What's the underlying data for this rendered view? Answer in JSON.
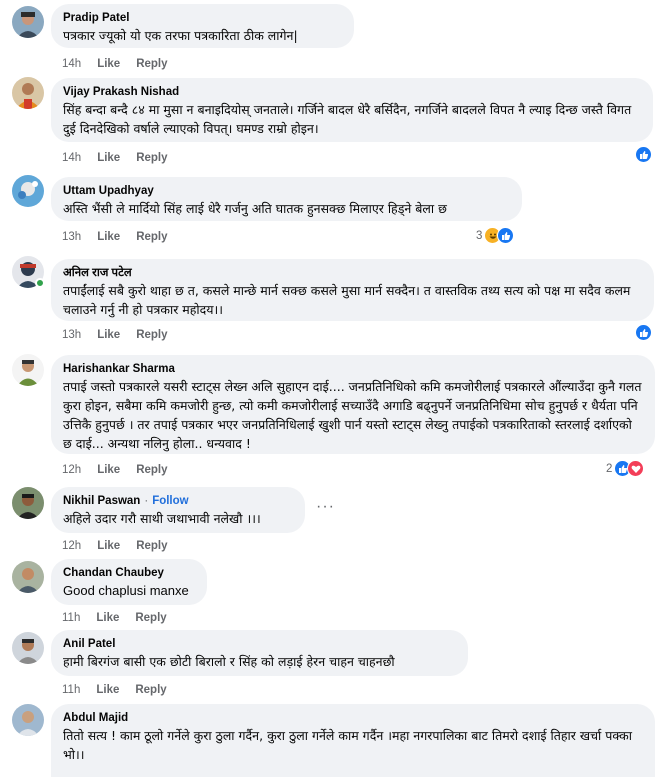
{
  "comments": [
    {
      "author": "Pradip Patel",
      "text": "पत्रकार ज्यूको यो एक तरफा पत्रकारिता ठीक लागेन|",
      "time": "14h",
      "like": "Like",
      "reply": "Reply"
    },
    {
      "author": "Vijay Prakash Nishad",
      "text": "सिंह बन्दा बन्दै ८४ मा मुसा न बनाइदियोस् जनताले। गर्जिने बादल धेरै बर्सिदैन, नगर्जिने बादलले विपत नै ल्याइ दिन्छ जस्तै विगत दुई दिनदेखिको वर्षाले ल्याएको विपत्। घमण्ड राम्रो होइन।",
      "time": "14h",
      "like": "Like",
      "reply": "Reply"
    },
    {
      "author": "Uttam Upadhyay",
      "text": "अस्ति भैंसी ले मार्दियो सिंह लाई धेरै गर्जनु अति घातक हुनसक्छ मिलाएर हिड्ने बेला छ",
      "time": "13h",
      "like": "Like",
      "reply": "Reply",
      "reaction_count": "3"
    },
    {
      "author": "अनिल राज पटेल",
      "text": "तपाईंलाई सबै कुरो थाहा छ त, कसले मान्छे मार्न सक्छ कसले मुसा मार्न सक्दैन। त वास्तविक तथ्य सत्य को पक्ष मा सदैव कलम चलाउने गर्नु नी हो पत्रकार महोदय।।",
      "time": "13h",
      "like": "Like",
      "reply": "Reply"
    },
    {
      "author": "Harishankar Sharma",
      "text": "तपाई जस्तो पत्रकारले यसरी स्टाट्स लेख्न अलि सुहाएन दाई.... जनप्रतिनिधिको कमि कमजोरीलाई पत्रकारले औंल्याउँदा कुनै गलत कुरा होइन, सबैमा कमि कमजोरी हुन्छ, त्यो कमी कमजोरीलाई सच्याउँदै अगाडि बढ्नुपर्ने जनप्रतिनिधिमा सोच हुनुपर्छ र धैर्यता पनि उत्तिकै हुनुपर्छ । तर तपाई पत्रकार भएर जनप्रतिनिधिलाई खुशी पार्न यस्तो स्टाट्स लेख्नु तपाईको पत्रकारिताको स्तरलाई दर्शाएको छ दाई... अन्यथा नलिनु होला.. धन्यवाद !",
      "time": "12h",
      "like": "Like",
      "reply": "Reply",
      "reaction_count": "2"
    },
    {
      "author": "Nikhil Paswan",
      "follow": "Follow",
      "text": "अहिले उदार गरौ साथी जथाभावी नलेखौ ।।।",
      "time": "12h",
      "like": "Like",
      "reply": "Reply",
      "more": "···"
    },
    {
      "author": "Chandan Chaubey",
      "text": "Good chaplusi manxe",
      "time": "11h",
      "like": "Like",
      "reply": "Reply"
    },
    {
      "author": "Anil Patel",
      "text": "हामी बिरगंज बासी एक छोटी बिरालो र सिंह को लड़ाई हेरन चाहन चाहनछौ",
      "time": "11h",
      "like": "Like",
      "reply": "Reply"
    },
    {
      "author": "Abdul Majid",
      "text": "तितो सत्य ! काम ठूलो गर्नेले कुरा ठुला गर्दैन, कुरा ठुला गर्नेले काम गर्दैन ।महा नगरपालिका बाट तिमरो दशाई तिहार खर्चा पक्का भो।।",
      "time": "",
      "like": "",
      "reply": ""
    }
  ],
  "icons": {
    "like_reaction": "like-icon",
    "haha_reaction": "haha-icon",
    "love_reaction": "love-icon"
  },
  "colors": {
    "bubble": "#f0f2f5",
    "like_blue": "#1877f2",
    "love_red": "#f33e58",
    "haha_yellow": "#f7b125",
    "follow_blue": "#216fdb"
  }
}
